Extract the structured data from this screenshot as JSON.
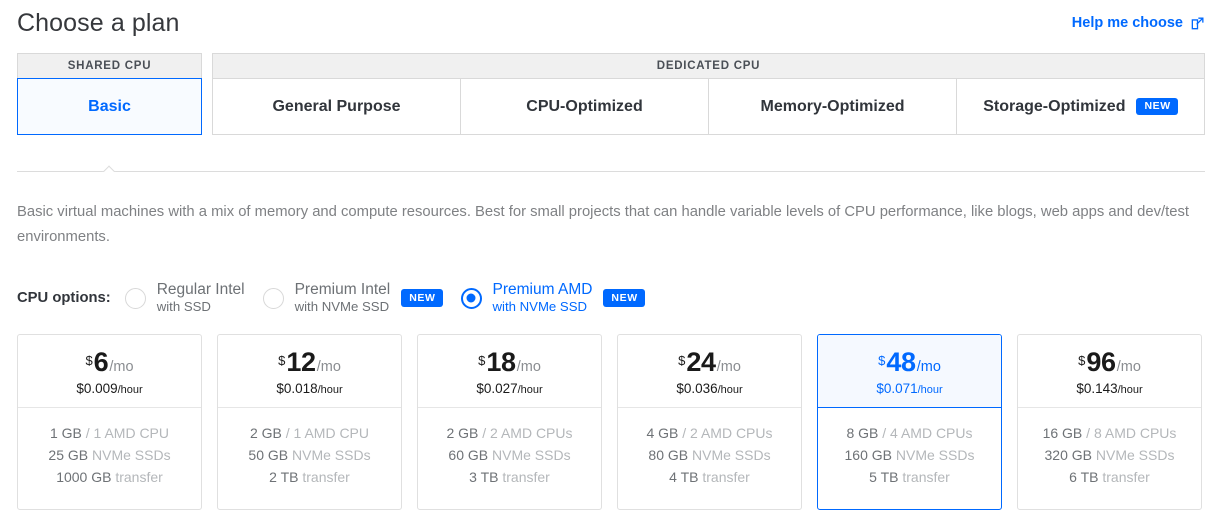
{
  "header": {
    "title": "Choose a plan",
    "help_link": "Help me choose",
    "help_icon": "external-link-icon"
  },
  "tab_groups": [
    {
      "name": "shared",
      "header": "SHARED CPU",
      "tabs": [
        {
          "label": "Basic",
          "selected": true,
          "badge": ""
        }
      ]
    },
    {
      "name": "dedicated",
      "header": "DEDICATED CPU",
      "tabs": [
        {
          "label": "General Purpose",
          "selected": false,
          "badge": ""
        },
        {
          "label": "CPU-Optimized",
          "selected": false,
          "badge": ""
        },
        {
          "label": "Memory-Optimized",
          "selected": false,
          "badge": ""
        },
        {
          "label": "Storage-Optimized",
          "selected": false,
          "badge": "NEW"
        }
      ]
    }
  ],
  "description": "Basic virtual machines with a mix of memory and compute resources. Best for small projects that can handle variable levels of CPU performance, like blogs, web apps and dev/test environments.",
  "cpu_options": {
    "label": "CPU options:",
    "options": [
      {
        "title": "Regular Intel",
        "subtitle": "with SSD",
        "badge": "",
        "checked": false
      },
      {
        "title": "Premium Intel",
        "subtitle": "with NVMe SSD",
        "badge": "NEW",
        "checked": false
      },
      {
        "title": "Premium AMD",
        "subtitle": "with NVMe SSD",
        "badge": "NEW",
        "checked": true
      }
    ]
  },
  "plans": [
    {
      "currency": "$",
      "amount": "6",
      "period": "/mo",
      "hourly_price": "$0.009",
      "hourly_unit": "/hour",
      "memory": "1 GB",
      "cpu": "/ 1 AMD CPU",
      "disk_value": "25 GB",
      "disk_label": "NVMe SSDs",
      "transfer_value": "1000 GB",
      "transfer_label": "transfer",
      "selected": false
    },
    {
      "currency": "$",
      "amount": "12",
      "period": "/mo",
      "hourly_price": "$0.018",
      "hourly_unit": "/hour",
      "memory": "2 GB",
      "cpu": "/ 1 AMD CPU",
      "disk_value": "50 GB",
      "disk_label": "NVMe SSDs",
      "transfer_value": "2 TB",
      "transfer_label": "transfer",
      "selected": false
    },
    {
      "currency": "$",
      "amount": "18",
      "period": "/mo",
      "hourly_price": "$0.027",
      "hourly_unit": "/hour",
      "memory": "2 GB",
      "cpu": "/ 2 AMD CPUs",
      "disk_value": "60 GB",
      "disk_label": "NVMe SSDs",
      "transfer_value": "3 TB",
      "transfer_label": "transfer",
      "selected": false
    },
    {
      "currency": "$",
      "amount": "24",
      "period": "/mo",
      "hourly_price": "$0.036",
      "hourly_unit": "/hour",
      "memory": "4 GB",
      "cpu": "/ 2 AMD CPUs",
      "disk_value": "80 GB",
      "disk_label": "NVMe SSDs",
      "transfer_value": "4 TB",
      "transfer_label": "transfer",
      "selected": false
    },
    {
      "currency": "$",
      "amount": "48",
      "period": "/mo",
      "hourly_price": "$0.071",
      "hourly_unit": "/hour",
      "memory": "8 GB",
      "cpu": "/ 4 AMD CPUs",
      "disk_value": "160 GB",
      "disk_label": "NVMe SSDs",
      "transfer_value": "5 TB",
      "transfer_label": "transfer",
      "selected": true
    },
    {
      "currency": "$",
      "amount": "96",
      "period": "/mo",
      "hourly_price": "$0.143",
      "hourly_unit": "/hour",
      "memory": "16 GB",
      "cpu": "/ 8 AMD CPUs",
      "disk_value": "320 GB",
      "disk_label": "NVMe SSDs",
      "transfer_value": "6 TB",
      "transfer_label": "transfer",
      "selected": false
    }
  ],
  "colors": {
    "accent": "#0069ff",
    "selected_bg": "#f5f9ff",
    "border": "#e0e0e0",
    "group_header_bg": "#f0f0f0",
    "muted_text": "#b4b7ba",
    "body_text": "#31353b"
  }
}
